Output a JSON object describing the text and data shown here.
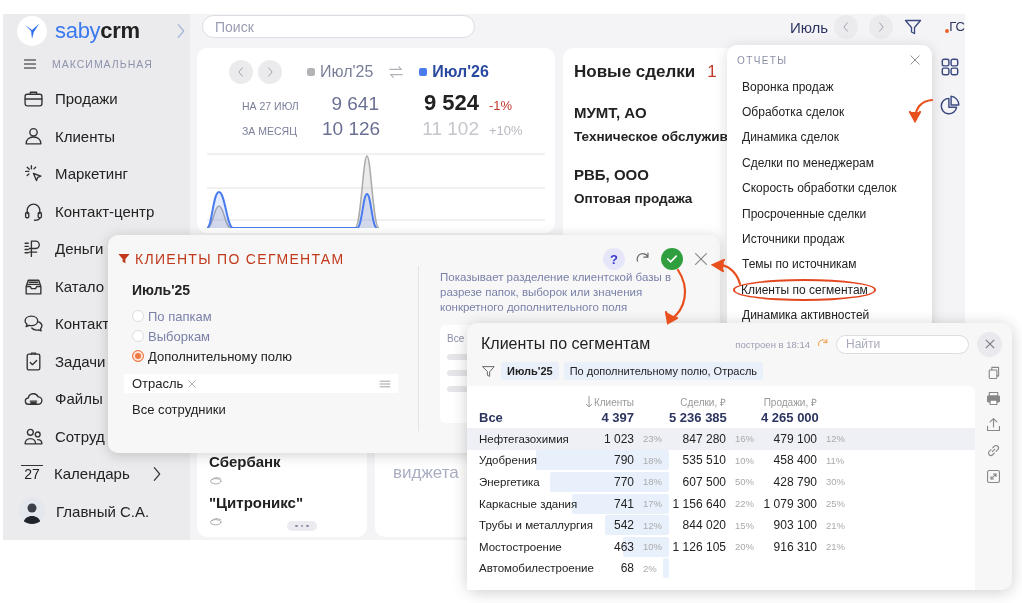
{
  "sidebar": {
    "brand": "saby",
    "product": "crm",
    "mode": "МАКСИМАЛЬНАЯ",
    "items": [
      {
        "kind": "section",
        "label": "Продажи",
        "expandable": false
      },
      {
        "kind": "section",
        "label": "Клиенты",
        "expandable": false
      },
      {
        "kind": "section",
        "label": "Маркетинг",
        "expandable": false
      },
      {
        "kind": "section",
        "label": "Контакт-центр",
        "expandable": false
      },
      {
        "kind": "section",
        "label": "Деньги",
        "expandable": false
      },
      {
        "kind": "section",
        "label": "Катало",
        "expandable": false
      },
      {
        "kind": "section",
        "label": "Контакт",
        "expandable": false
      },
      {
        "kind": "section",
        "label": "Задачи",
        "expandable": false
      },
      {
        "kind": "section",
        "label": "Файлы",
        "expandable": false
      },
      {
        "kind": "section",
        "label": "Сотруд",
        "expandable": false
      },
      {
        "kind": "calendar",
        "icon_text": "27",
        "label": "Календарь",
        "expandable": true
      },
      {
        "kind": "user",
        "label": "Главный С.А.",
        "expandable": false
      }
    ]
  },
  "topbar": {
    "search_placeholder": "Поиск",
    "period": "Июль",
    "user_initials": "ГС"
  },
  "sales_card": {
    "legend": [
      {
        "label": "Июл'25",
        "color": "#b4b4b8",
        "selected": false
      },
      {
        "label": "Июл'26",
        "color": "#4a7cf0",
        "selected": true
      }
    ],
    "rows": [
      {
        "kind": "fact",
        "label": "НА 27 ИЮЛ",
        "previous": "9 641",
        "current": "9 524",
        "change": "-1%"
      },
      {
        "kind": "forecast",
        "label": "ЗА МЕСЯЦ",
        "previous": "10 126",
        "current": "11 102",
        "change": "+10%"
      }
    ]
  },
  "deals_card": {
    "title": "Новые сделки",
    "count": "1",
    "deals": [
      {
        "name": "МУМТ, АО",
        "description": "Техническое обслужив"
      },
      {
        "name": "РВБ, ООО",
        "description": "Оптовая продажа"
      }
    ]
  },
  "bottom_cards": [
    {
      "kind": "companies",
      "companies": [
        "Сбербанк",
        "\"Цитроникс\""
      ]
    },
    {
      "kind": "placeholder",
      "text": "виджета"
    }
  ],
  "filter_popup": {
    "title": "КЛИЕНТЫ ПО СЕГМЕНТАМ",
    "help": "?",
    "period": "Июль'25",
    "options": [
      {
        "label": "По папкам",
        "selected": false
      },
      {
        "label": "Выборкам",
        "selected": false
      },
      {
        "label": "Дополнительному полю",
        "selected": true
      }
    ],
    "field_value": "Отрасль",
    "employees": "Все сотрудники",
    "description": "Показывает разделение клиентской базы в разрезе папок, выборок или значения конкретного дополнительного поля",
    "preview_label": "Все"
  },
  "reports_menu": {
    "title": "ОТЧЕТЫ",
    "items": [
      {
        "label": "Воронка продаж",
        "highlighted": false
      },
      {
        "label": "Обработка сделок",
        "highlighted": false
      },
      {
        "label": "Динамика сделок",
        "highlighted": false
      },
      {
        "label": "Сделки по менеджерам",
        "highlighted": false
      },
      {
        "label": "Скорость обработки сделок",
        "highlighted": false
      },
      {
        "label": "Просроченные сделки",
        "highlighted": false
      },
      {
        "label": "Источники продаж",
        "highlighted": false
      },
      {
        "label": "Темы по источникам",
        "highlighted": false
      },
      {
        "label": "Клиенты по сегментам",
        "highlighted": true
      },
      {
        "label": "Динамика активностей",
        "highlighted": false
      }
    ]
  },
  "report": {
    "title": "Клиенты по сегментам",
    "built": "построен в 18:14",
    "search_placeholder": "Найти",
    "filters": [
      "Июль'25",
      "По дополнительному полю, Отрасль"
    ],
    "columns": [
      "Клиенты",
      "Сделки, ₽",
      "Продажи, ₽"
    ],
    "total": {
      "label": "Все",
      "clients": "4 397",
      "deals": "5 236 385",
      "sales": "4 265 000"
    },
    "rows": [
      {
        "name": "Нефтегазохимия",
        "clients": "1 023",
        "clients_pct": "23%",
        "deals": "847 280",
        "deals_pct": "16%",
        "sales": "479 100",
        "sales_pct": "12%",
        "selected": true
      },
      {
        "name": "Удобрения",
        "clients": "790",
        "clients_pct": "18%",
        "deals": "535 510",
        "deals_pct": "10%",
        "sales": "458 400",
        "sales_pct": "11%",
        "selected": false
      },
      {
        "name": "Энергетика",
        "clients": "770",
        "clients_pct": "18%",
        "deals": "607 500",
        "deals_pct": "50%",
        "sales": "428 790",
        "sales_pct": "30%",
        "selected": false
      },
      {
        "name": "Каркасные здания",
        "clients": "741",
        "clients_pct": "17%",
        "deals": "1 156 640",
        "deals_pct": "22%",
        "sales": "1 079 300",
        "sales_pct": "25%",
        "selected": false
      },
      {
        "name": "Трубы и металлургия",
        "clients": "542",
        "clients_pct": "12%",
        "deals": "844 020",
        "deals_pct": "15%",
        "sales": "903 100",
        "sales_pct": "21%",
        "selected": false
      },
      {
        "name": "Мостостроение",
        "clients": "463",
        "clients_pct": "10%",
        "deals": "1 126 105",
        "deals_pct": "20%",
        "sales": "916 310",
        "sales_pct": "21%",
        "selected": false
      },
      {
        "name": "Автомобилестроение",
        "clients": "68",
        "clients_pct": "2%",
        "selected": false
      }
    ]
  }
}
